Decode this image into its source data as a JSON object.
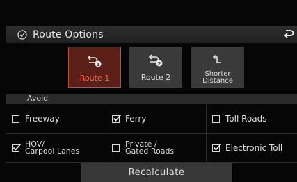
{
  "header": {
    "title": "Route Options",
    "title_icon": "check-circle-icon",
    "back_icon": "back-arrow-icon"
  },
  "routes": [
    {
      "label": "Route 1",
      "icon": "route-1-icon",
      "selected": true
    },
    {
      "label": "Route 2",
      "icon": "route-2-icon",
      "selected": false
    },
    {
      "label": "Shorter\nDistance",
      "icon": "shorter-distance-icon",
      "selected": false
    }
  ],
  "avoid": {
    "label": "Avoid",
    "options": [
      {
        "label": "Freeway",
        "checked": false
      },
      {
        "label": "Ferry",
        "checked": true
      },
      {
        "label": "Toll Roads",
        "checked": false
      },
      {
        "label": "HOV/\nCarpool Lanes",
        "checked": true
      },
      {
        "label": "Private /\nGated Roads",
        "checked": false
      },
      {
        "label": "Electronic Toll",
        "checked": true
      }
    ]
  },
  "recalculate_label": "Recalculate",
  "colors": {
    "accent": "#ff6b55",
    "selected_bg": "#5a1f17",
    "button_bg": "#3a3a3a",
    "header_bg": "#2e2e2e"
  }
}
